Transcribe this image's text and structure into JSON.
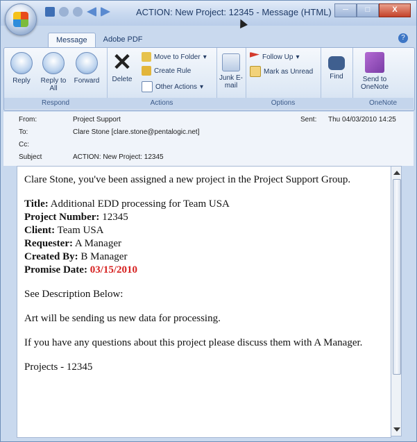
{
  "window": {
    "title": "ACTION: New Project: 12345 - Message (HTML)",
    "min_icon": "minimize-icon",
    "max_icon": "maximize-icon",
    "close_label": "X"
  },
  "tabs": [
    "Message",
    "Adobe PDF"
  ],
  "ribbon": {
    "respond": {
      "label": "Respond",
      "reply": "Reply",
      "reply_all": "Reply to All",
      "forward": "Forward"
    },
    "actions": {
      "label": "Actions",
      "delete": "Delete",
      "move": "Move to Folder",
      "create_rule": "Create Rule",
      "other": "Other Actions"
    },
    "junk": {
      "label": "Junk E-mail"
    },
    "options": {
      "label": "Options",
      "follow_up": "Follow Up",
      "mark_unread": "Mark as Unread"
    },
    "find": {
      "label": "Find"
    },
    "onenote": {
      "label": "OneNote",
      "send": "Send to OneNote"
    }
  },
  "headers": {
    "from_label": "From:",
    "from": "Project Support",
    "to_label": "To:",
    "to": "Clare Stone [clare.stone@pentalogic.net]",
    "cc_label": "Cc:",
    "cc": "",
    "subject_label": "Subject",
    "subject": "ACTION: New Project: 12345",
    "sent_label": "Sent:",
    "sent": "Thu 04/03/2010 14:25"
  },
  "body": {
    "intro": "Clare Stone, you've been assigned a new project in the Project Support Group.",
    "title_label": "Title:",
    "title": "Additional EDD processing for Team USA",
    "number_label": "Project Number:",
    "number": "12345",
    "client_label": "Client:",
    "client": "Team USA",
    "requester_label": "Requester:",
    "requester": "A Manager",
    "created_label": "Created By:",
    "created": "B Manager",
    "promise_label": "Promise Date:",
    "promise": "03/15/2010",
    "see_desc": "See Description Below:",
    "description": "Art will be sending us new data for processing.",
    "questions": "If you have any questions about this project please discuss them with A Manager.",
    "footer": "Projects - 12345"
  }
}
